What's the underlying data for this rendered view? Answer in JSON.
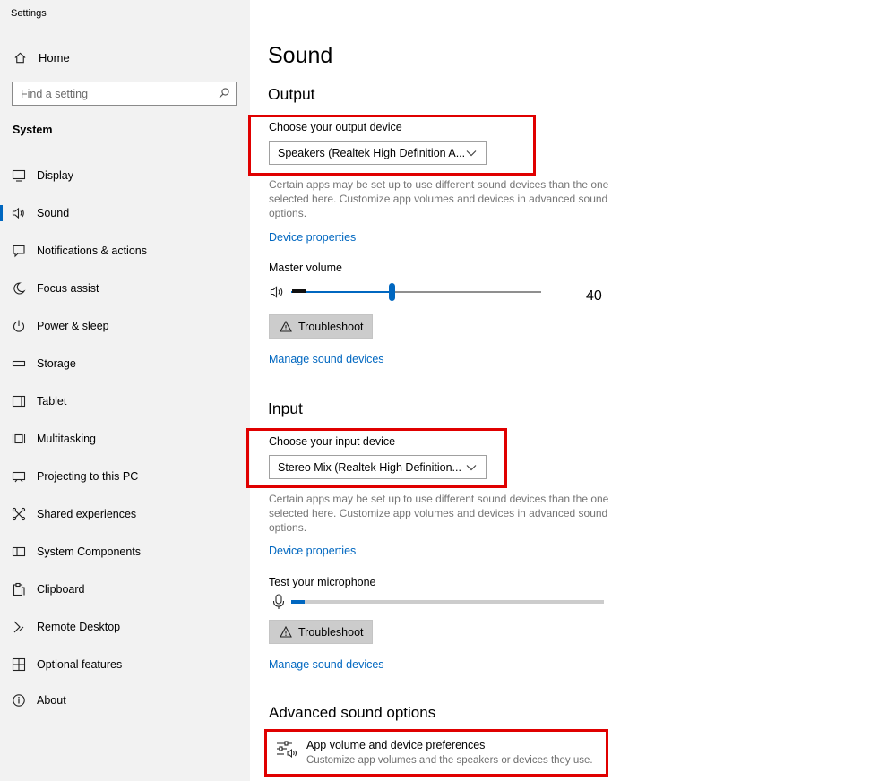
{
  "window": {
    "title": "Settings"
  },
  "sidebar": {
    "home_label": "Home",
    "search_placeholder": "Find a setting",
    "section": "System",
    "items": [
      {
        "label": "Display",
        "icon": "display-icon"
      },
      {
        "label": "Sound",
        "icon": "speaker-icon",
        "selected": true
      },
      {
        "label": "Notifications & actions",
        "icon": "notification-icon"
      },
      {
        "label": "Focus assist",
        "icon": "moon-icon"
      },
      {
        "label": "Power & sleep",
        "icon": "power-icon"
      },
      {
        "label": "Storage",
        "icon": "storage-icon"
      },
      {
        "label": "Tablet",
        "icon": "tablet-icon"
      },
      {
        "label": "Multitasking",
        "icon": "multitasking-icon"
      },
      {
        "label": "Projecting to this PC",
        "icon": "projecting-icon"
      },
      {
        "label": "Shared experiences",
        "icon": "shared-icon"
      },
      {
        "label": "System Components",
        "icon": "components-icon"
      },
      {
        "label": "Clipboard",
        "icon": "clipboard-icon"
      },
      {
        "label": "Remote Desktop",
        "icon": "remote-desktop-icon"
      },
      {
        "label": "Optional features",
        "icon": "optional-features-icon"
      },
      {
        "label": "About",
        "icon": "info-icon"
      }
    ]
  },
  "main": {
    "title": "Sound",
    "output": {
      "heading": "Output",
      "device_label": "Choose your output device",
      "device_value": "Speakers (Realtek High Definition A...",
      "help": "Certain apps may be set up to use different sound devices than the one selected here. Customize app volumes and devices in advanced sound options.",
      "properties_link": "Device properties",
      "volume_label": "Master volume",
      "volume_value": "40",
      "volume_fraction": 0.4,
      "troubleshoot": "Troubleshoot",
      "manage_link": "Manage sound devices"
    },
    "input": {
      "heading": "Input",
      "device_label": "Choose your input device",
      "device_value": "Stereo Mix (Realtek High Definition...",
      "help": "Certain apps may be set up to use different sound devices than the one selected here. Customize app volumes and devices in advanced sound options.",
      "properties_link": "Device properties",
      "mic_label": "Test your microphone",
      "troubleshoot": "Troubleshoot",
      "manage_link": "Manage sound devices"
    },
    "advanced": {
      "heading": "Advanced sound options",
      "item_title": "App volume and device preferences",
      "item_desc": "Customize app volumes and the speakers or devices they use."
    }
  },
  "colors": {
    "accent": "#0067c0",
    "highlight": "#e00000",
    "sidebar_bg": "#f2f2f2"
  }
}
